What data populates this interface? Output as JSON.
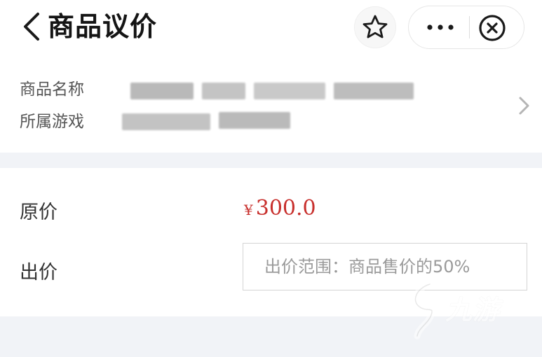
{
  "header": {
    "title": "商品议价",
    "icons": {
      "back": "chevron-left-icon",
      "favorite": "star-icon",
      "more": "more-dots-icon",
      "close": "close-circle-icon"
    }
  },
  "product": {
    "name_label": "商品名称",
    "game_label": "所属游戏",
    "chevron": "chevron-right-icon"
  },
  "pricing": {
    "original_label": "原价",
    "currency_symbol": "¥",
    "original_price": "300.0",
    "bid_label": "出价",
    "bid_placeholder": "出价范围：商品售价的50%",
    "bid_value": ""
  },
  "watermark": {
    "text": "九游",
    "icon": "jiuyou-logo-icon"
  },
  "colors": {
    "price_red": "#c8302d",
    "band_gray": "#f1f3f7",
    "title_black": "#141414"
  }
}
